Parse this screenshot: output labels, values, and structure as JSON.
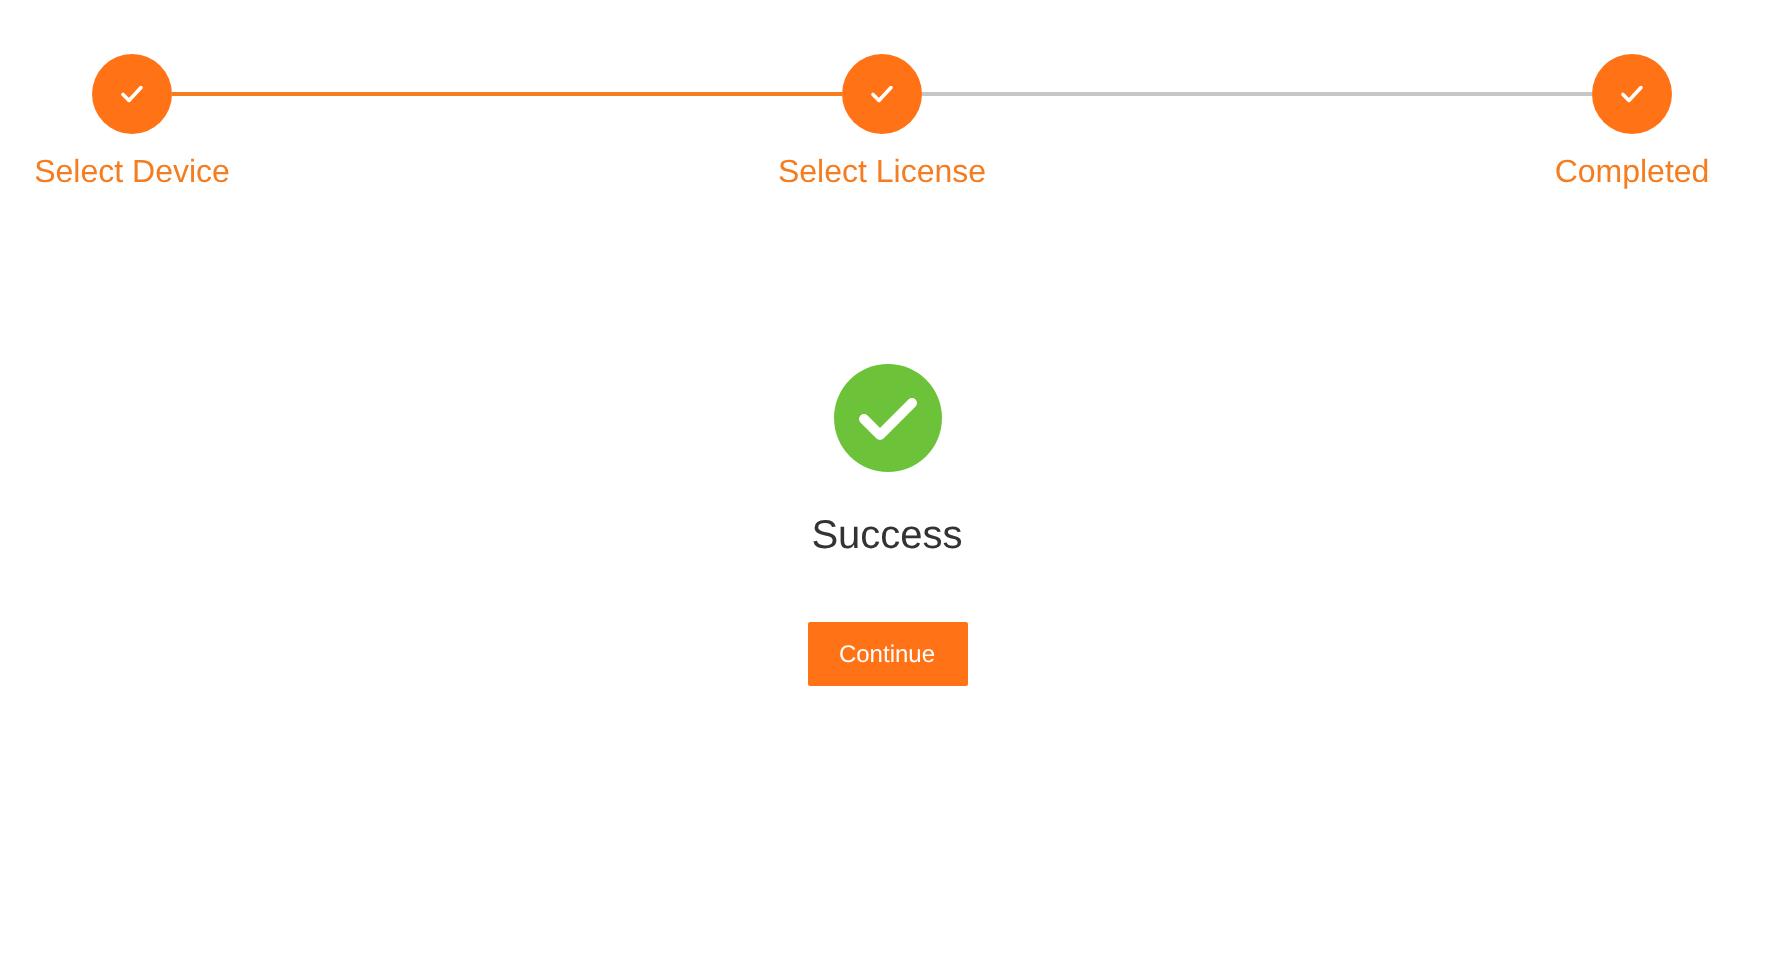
{
  "steps": [
    {
      "label": "Select Device",
      "completed": true
    },
    {
      "label": "Select License",
      "completed": true
    },
    {
      "label": "Completed",
      "completed": true
    }
  ],
  "connectors": [
    {
      "completed": true
    },
    {
      "completed": false
    }
  ],
  "result": {
    "success": true,
    "message": "Success"
  },
  "button": {
    "label": "Continue"
  }
}
